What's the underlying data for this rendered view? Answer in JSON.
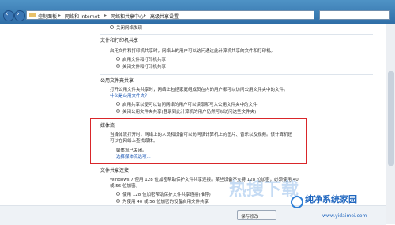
{
  "titlebar": {
    "breadcrumb": [
      "控制面板",
      "网络和 Internet",
      "网络和共享中心",
      "高级共享设置"
    ],
    "separator": "▸"
  },
  "sections": {
    "top_option": "关闭网络发现",
    "printer": {
      "title": "文件和打印机共享",
      "desc": "启用文件和打印机共享时，网络上的用户可以访问通过此计算机共享的文件和打印机。",
      "options": [
        "启用文件和打印机共享",
        "关闭文件和打印机共享"
      ],
      "selected": 1
    },
    "public": {
      "title": "公用文件夹共享",
      "desc": "打开公用文件夹共享时，网络上包括家庭组成员在内的用户都可以访问公用文件夹中的文件。",
      "link": "什么是公用文件夹？",
      "options": [
        "启用共享以便可以访问网络的用户可以读取和写入公用文件夹中的文件",
        "关闭公用文件夹共享(登录到此计算机的用户仍然可以访问这些文件夹)"
      ],
      "selected": 0
    },
    "media": {
      "title": "媒体流",
      "desc1": "当媒体流打开时，网络上的人员和设备可以访问该计算机上的图片、音乐以及视频。该计算机还",
      "desc2": "可以在网络上查找媒体。",
      "status": "媒体流已关闭。",
      "link": "选择媒体流选项..."
    },
    "connection": {
      "title": "文件共享连接",
      "desc1": "Windows 7 使用 128 位加密帮助保护文件共享连接。某些设备不支持 128 位加密，必须使用 40",
      "desc2": "或 56 位加密。",
      "options": [
        "使用 128 位加密帮助保护文件共享连接(推荐)",
        "为使用 40 或 56 位加密的设备启用文件共享"
      ],
      "selected": 0
    }
  },
  "buttons": {
    "save": "保存修改"
  },
  "watermark": {
    "big": "热搜下载",
    "brand": "纯净系统家园",
    "url": "www.yidaimei.com"
  }
}
